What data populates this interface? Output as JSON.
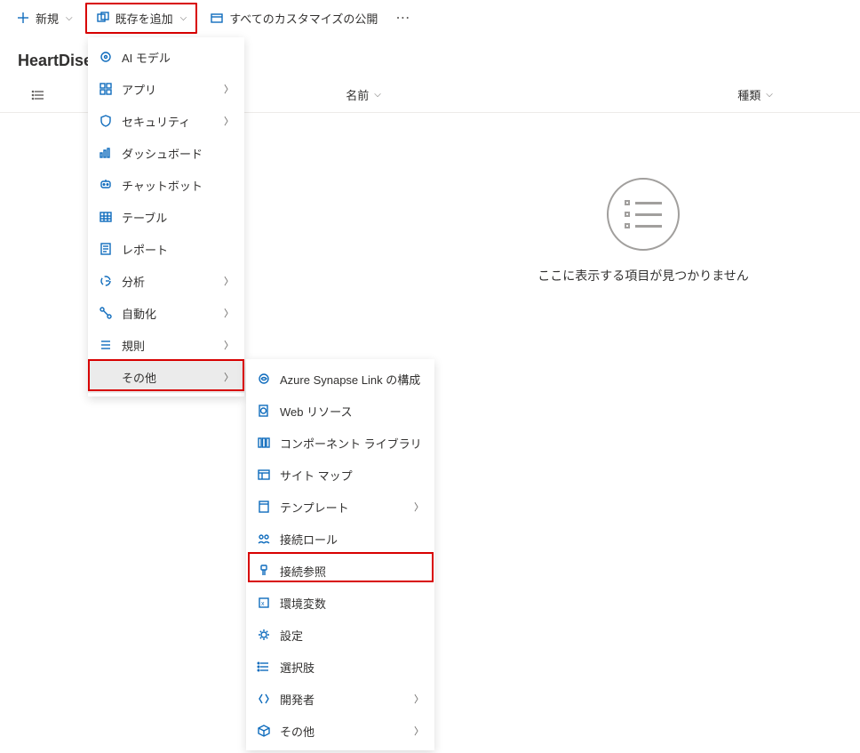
{
  "toolbar": {
    "new_label": "新規",
    "add_existing_label": "既存を追加",
    "publish_label": "すべてのカスタマイズの公開"
  },
  "page": {
    "title": "HeartDise"
  },
  "columns": {
    "name": "名前",
    "type": "種類"
  },
  "empty_state": {
    "message": "ここに表示する項目が見つかりません"
  },
  "menu1": {
    "ai_model": "AI モデル",
    "app": "アプリ",
    "security": "セキュリティ",
    "dashboard": "ダッシュボード",
    "chatbot": "チャットボット",
    "table": "テーブル",
    "report": "レポート",
    "analysis": "分析",
    "automation": "自動化",
    "rule": "規則",
    "other": "その他"
  },
  "menu2": {
    "synapse": "Azure Synapse Link の構成",
    "webres": "Web リソース",
    "component": "コンポーネント ライブラリ",
    "sitemap": "サイト マップ",
    "template": "テンプレート",
    "connrole": "接続ロール",
    "connref": "接続参照",
    "envvar": "環境変数",
    "settings": "設定",
    "choice": "選択肢",
    "developer": "開発者",
    "other": "その他"
  }
}
